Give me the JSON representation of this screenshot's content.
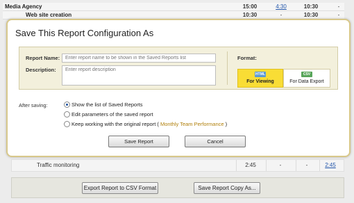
{
  "report": {
    "rows": [
      {
        "name": "Media Agency",
        "c1": "15:00",
        "c2": "4:30",
        "c3": "10:30",
        "c4": "-"
      },
      {
        "name": "Web site creation",
        "c1": "10:30",
        "c2": "-",
        "c3": "10:30",
        "c4": "-"
      }
    ],
    "traffic_row": {
      "name": "Traffic monitoring",
      "c1": "2:45",
      "c2": "-",
      "c3": "-",
      "c4": "2:45"
    },
    "export_csv_label": "Export Report to CSV Format",
    "save_copy_label": "Save Report Copy As..."
  },
  "dialog": {
    "title": "Save This Report Configuration As",
    "report_name_label": "Report Name:",
    "report_name_placeholder": "Enter report name to be shown in the Saved Reports list",
    "description_label": "Description:",
    "description_placeholder": "Enter report description",
    "format_label": "Format:",
    "formats": [
      {
        "icon": "html-icon",
        "icon_text": "HTML",
        "label": "For Viewing",
        "selected": true
      },
      {
        "icon": "csv-icon",
        "icon_text": "CSV",
        "label": "For Data Export",
        "selected": false
      }
    ],
    "after_saving_label": "After saving:",
    "options": [
      {
        "label": "Show the list of Saved Reports",
        "checked": true
      },
      {
        "label": "Edit parameters of the saved report",
        "checked": false
      },
      {
        "label": "Keep working with the original report (",
        "link": "Monthly Team Performance",
        "suffix": ")",
        "checked": false
      }
    ],
    "save_label": "Save Report",
    "cancel_label": "Cancel"
  },
  "colors": {
    "selected_format": "#f9dd35",
    "panel": "#f3f0dc",
    "link": "#2255aa",
    "dialog_border": "#d8c88a"
  }
}
